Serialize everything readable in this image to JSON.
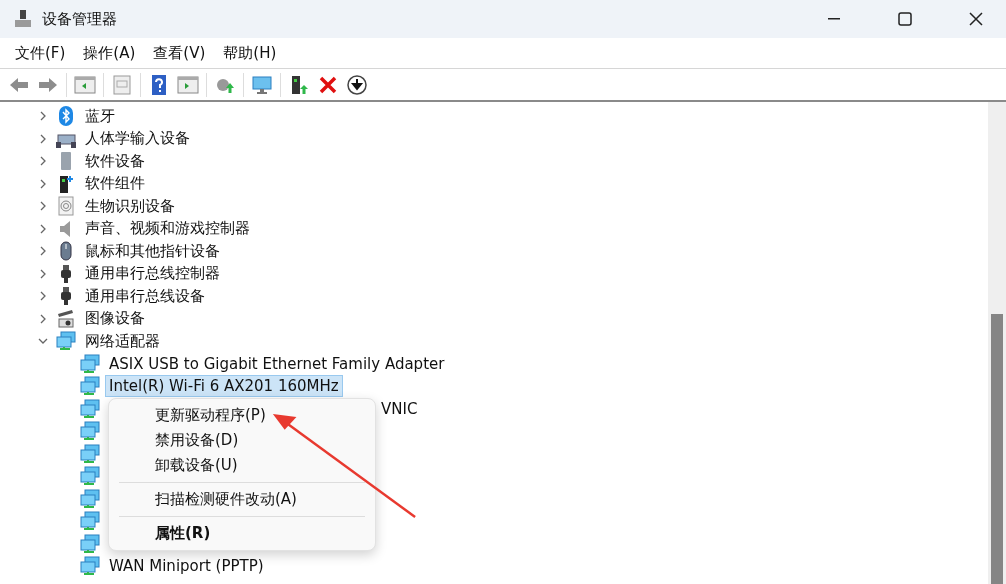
{
  "window": {
    "title": "设备管理器"
  },
  "menu_bar": [
    "文件(F)",
    "操作(A)",
    "查看(V)",
    "帮助(H)"
  ],
  "toolbar": [
    {
      "kind": "back"
    },
    {
      "kind": "forward"
    },
    {
      "kind": "sep"
    },
    {
      "kind": "panel"
    },
    {
      "kind": "sep"
    },
    {
      "kind": "doc"
    },
    {
      "kind": "sep"
    },
    {
      "kind": "help"
    },
    {
      "kind": "panel2"
    },
    {
      "kind": "sep"
    },
    {
      "kind": "update"
    },
    {
      "kind": "sep"
    },
    {
      "kind": "scan"
    },
    {
      "kind": "sep"
    },
    {
      "kind": "enable"
    },
    {
      "kind": "remove"
    },
    {
      "kind": "download"
    }
  ],
  "tree": [
    {
      "label": "蓝牙",
      "kind": "bluetooth",
      "expanded": false
    },
    {
      "label": "人体学输入设备",
      "kind": "hid",
      "expanded": false
    },
    {
      "label": "软件设备",
      "kind": "tower",
      "expanded": false
    },
    {
      "label": "软件组件",
      "kind": "component",
      "expanded": false
    },
    {
      "label": "生物识别设备",
      "kind": "fingerprint",
      "expanded": false
    },
    {
      "label": "声音、视频和游戏控制器",
      "kind": "speaker",
      "expanded": false
    },
    {
      "label": "鼠标和其他指针设备",
      "kind": "mouse",
      "expanded": false
    },
    {
      "label": "通用串行总线控制器",
      "kind": "usb",
      "expanded": false
    },
    {
      "label": "通用串行总线设备",
      "kind": "usb",
      "expanded": false
    },
    {
      "label": "图像设备",
      "kind": "camera",
      "expanded": false
    },
    {
      "label": "网络适配器",
      "kind": "network",
      "expanded": true,
      "children": [
        {
          "label": "ASIX USB to Gigabit Ethernet Family Adapter",
          "kind": "full",
          "selected": false
        },
        {
          "label": "Intel(R) Wi-Fi 6 AX201 160MHz",
          "kind": "full",
          "selected": true
        },
        {
          "label": "VNIC",
          "kind": "partial"
        },
        {
          "kind": "covered"
        },
        {
          "kind": "covered"
        },
        {
          "kind": "covered"
        },
        {
          "kind": "covered"
        },
        {
          "kind": "covered"
        },
        {
          "kind": "covered"
        },
        {
          "label": "WAN Miniport (PPTP)",
          "kind": "full",
          "selected": false
        }
      ]
    }
  ],
  "context_menu": [
    {
      "label": "更新驱动程序(P)",
      "kind": "item"
    },
    {
      "label": "禁用设备(D)",
      "kind": "item"
    },
    {
      "label": "卸载设备(U)",
      "kind": "item"
    },
    {
      "kind": "separator"
    },
    {
      "label": "扫描检测硬件改动(A)",
      "kind": "item"
    },
    {
      "kind": "separator"
    },
    {
      "label": "属性(R)",
      "kind": "default"
    }
  ]
}
